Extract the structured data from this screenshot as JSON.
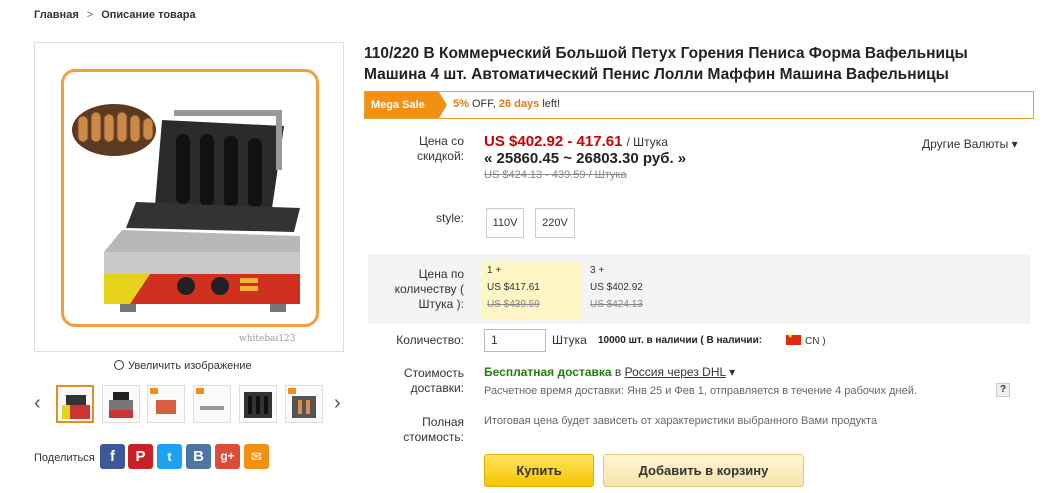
{
  "breadcrumb": {
    "home": "Главная",
    "separator": ">",
    "current": "Описание товара"
  },
  "product": {
    "title_line1": "110/220 В Коммерческий Большой Петух Горения Пениса Форма Вафельницы",
    "title_line2": "Машина 4 шт. Автоматический Пенис Лолли Маффин Машина Вафельницы",
    "watermark": "whitebai123"
  },
  "gallery": {
    "zoom_label": "Увеличить изображение",
    "prev_icon": "chevron-left-icon",
    "next_icon": "chevron-right-icon",
    "thumbnail_count": 6,
    "active_index": 0
  },
  "share": {
    "label": "Поделиться",
    "networks": [
      "facebook",
      "pinterest",
      "twitter",
      "vkontakte",
      "google-plus",
      "email"
    ]
  },
  "sale": {
    "tag": "Mega Sale",
    "percent": "5%",
    "off": "OFF,",
    "days": "26 days",
    "left": "left!"
  },
  "price": {
    "label_line1": "Цена со",
    "label_line2": "скидкой:",
    "current": "US $402.92 - 417.61",
    "unit": "/ Штука",
    "rub": "« 25860.45 ~ 26803.30 руб. »",
    "old": "US $424.13 - 439.59 / Штука",
    "currencies": "Другие Валюты"
  },
  "style": {
    "label": "style:",
    "options": [
      "110V",
      "220V"
    ]
  },
  "bulk": {
    "label_line1": "Цена по",
    "label_line2": "количеству (",
    "label_line3": "Штука ):",
    "tiers": [
      {
        "qty": "1 +",
        "price": "US $417.61",
        "old": "US $439.59"
      },
      {
        "qty": "3 +",
        "price": "US $402.92",
        "old": "US $424.13"
      }
    ]
  },
  "quantity": {
    "label": "Количество:",
    "value": "1",
    "unit": "Штука",
    "stock": "10000 шт. в наличии ( В наличии:",
    "country": "CN )"
  },
  "shipping": {
    "label_line1": "Стоимость",
    "label_line2": "доставки:",
    "free": "Бесплатная доставка",
    "to": "в",
    "link": "Россия через DHL",
    "note": "Расчетное время доставки: Янв 25 и Фев 1, отправляется в течение 4 рабочих дней.",
    "help": "?"
  },
  "total": {
    "label_line1": "Полная",
    "label_line2": "стоимость:",
    "note": "Итоговая цена будет зависеть от характеристики выбранного Вами продукта"
  },
  "actions": {
    "buy": "Купить",
    "cart": "Добавить в корзину"
  },
  "colors": {
    "sale_orange": "#f29111",
    "price_red": "#cc0000",
    "buy_yellow": "#f6c500",
    "free_green": "#2a7a0f"
  }
}
